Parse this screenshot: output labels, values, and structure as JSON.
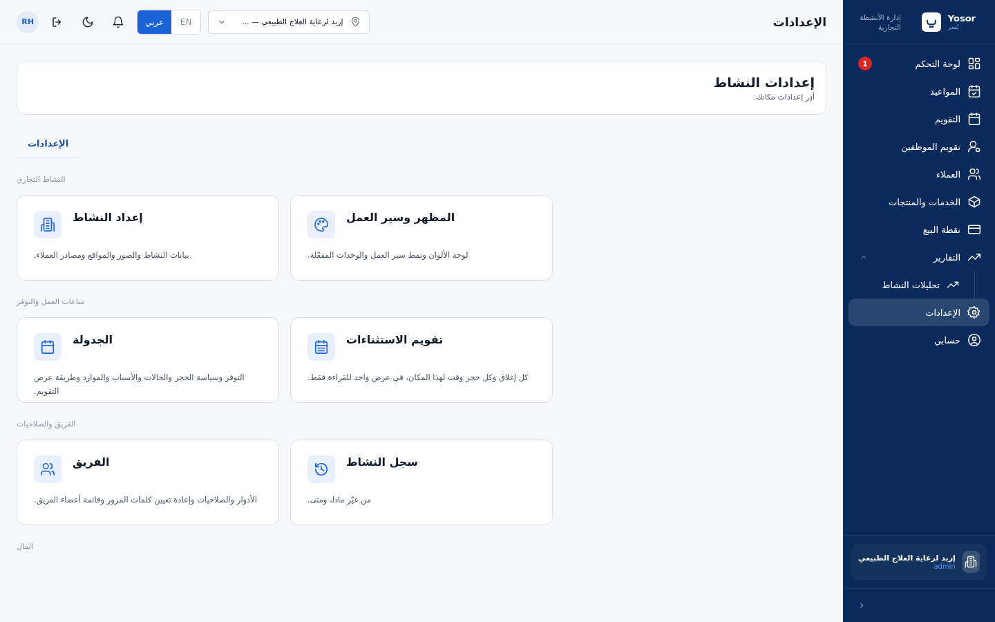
{
  "topbar": {
    "title": "الإعدادات",
    "avatar": "RH",
    "languages": [
      {
        "label": "EN",
        "selected": false
      },
      {
        "label": "عربي",
        "selected": true
      }
    ],
    "location": "إربد لرعاية العلاج الطبيعي — ..."
  },
  "sidebar": {
    "brand": "Yosor",
    "brand_sub": "يُسر",
    "tagline": "إدارة الأنشطة التجارية",
    "items": [
      {
        "label": "لوحة التحكم",
        "selected": false,
        "badge": "1"
      },
      {
        "label": "المواعيد",
        "selected": false
      },
      {
        "label": "التقويم",
        "selected": false
      },
      {
        "label": "تقويم الموظفين",
        "selected": false
      },
      {
        "label": "العملاء",
        "selected": false
      },
      {
        "label": "الخدمات والمنتجات",
        "selected": false
      },
      {
        "label": "نقطة البيع",
        "selected": false
      },
      {
        "label": "التقارير",
        "selected": false,
        "expanded": true,
        "children": [
          {
            "label": "تحليلات النشاط",
            "selected": false
          }
        ]
      },
      {
        "label": "الإعدادات",
        "selected": true
      },
      {
        "label": "حسابي",
        "selected": false
      }
    ],
    "business": {
      "name": "إربد لرعاية العلاج الطبيعي",
      "role": "admin"
    }
  },
  "page": {
    "title": "إعدادات النشاط",
    "subtitle": "أدِر إعدادات مكانك.",
    "tabs": [
      {
        "label": "الإعدادات",
        "selected": true
      }
    ],
    "sections": [
      {
        "title": "النشاط التجاري",
        "cards": [
          {
            "title": "المظهر وسير العمل",
            "description": "لوحة الألوان ونمط سير العمل والوحدات المفعّلة."
          },
          {
            "title": "إعداد النشاط",
            "description": "بيانات النشاط والصور والمواقع ومصادر العملاء."
          }
        ]
      },
      {
        "title": "ساعات العمل والتوفر",
        "cards": [
          {
            "title": "تقويم الاستثناءات",
            "description": "كل إغلاق وكل حجز وقت لهذا المكان، في عرض واحد للقراءة فقط."
          },
          {
            "title": "الجدولة",
            "description": "التوفر وسياسة الحجز والحالات والأسباب والموارد وطريقة عرض التقويم."
          }
        ]
      },
      {
        "title": "الفريق والصلاحيات",
        "cards": [
          {
            "title": "سجل النشاط",
            "description": "من غيّر ماذا، ومتى."
          },
          {
            "title": "الفريق",
            "description": "الأدوار والصلاحيات وإعادة تعيين كلمات المرور وقائمة أعضاء الفريق."
          }
        ]
      },
      {
        "title": "المال"
      }
    ]
  }
}
